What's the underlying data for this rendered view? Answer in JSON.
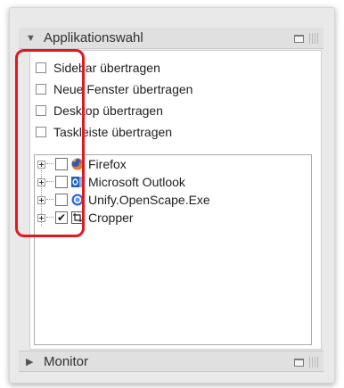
{
  "panel": {
    "header": {
      "title": "Applikationswahl",
      "collapse_icon": "triangle-down-icon"
    },
    "options": [
      {
        "label": "Sidebar übertragen",
        "checked": false
      },
      {
        "label": "Neue Fenster übertragen",
        "checked": false
      },
      {
        "label": "Desktop übertragen",
        "checked": false
      },
      {
        "label": "Taskleiste übertragen",
        "checked": false
      }
    ],
    "apps": [
      {
        "label": "Firefox",
        "checked": false,
        "icon": "firefox-icon"
      },
      {
        "label": "Microsoft Outlook",
        "checked": false,
        "icon": "outlook-icon"
      },
      {
        "label": "Unify.OpenScape.Exe",
        "checked": false,
        "icon": "openscape-icon"
      },
      {
        "label": "Cropper",
        "checked": true,
        "icon": "cropper-icon"
      }
    ],
    "footer": {
      "title": "Monitor",
      "expand_icon": "triangle-right-icon"
    },
    "colors": {
      "highlight": "#e0191f",
      "header_bg": "#e0e0e0"
    }
  }
}
